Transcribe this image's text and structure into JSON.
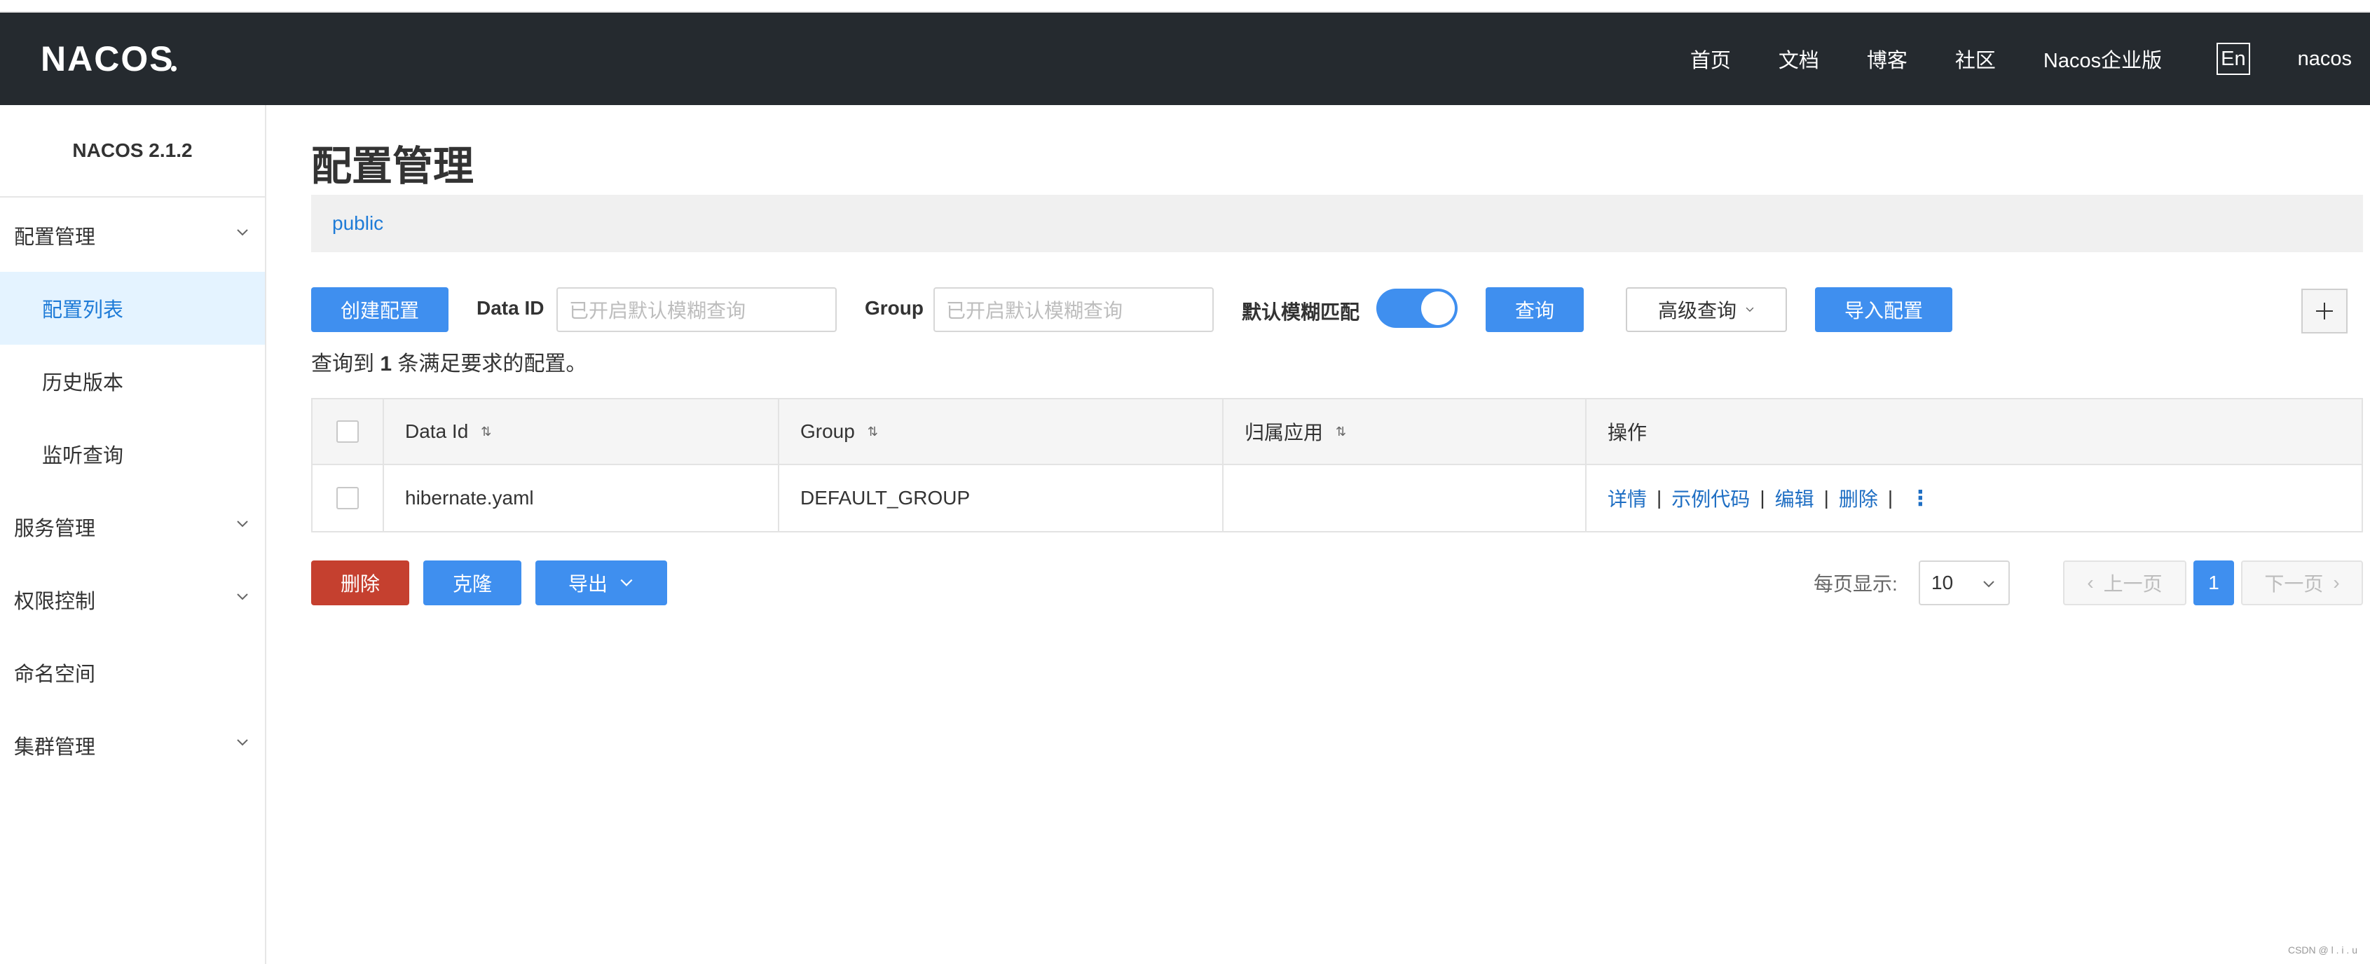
{
  "header": {
    "logo": "NACOS.",
    "nav": [
      "首页",
      "文档",
      "博客",
      "社区",
      "Nacos企业版"
    ],
    "lang": "En",
    "user": "nacos"
  },
  "sidebar": {
    "version": "NACOS 2.1.2",
    "items": [
      {
        "label": "配置管理"
      },
      {
        "label": "配置列表"
      },
      {
        "label": "历史版本"
      },
      {
        "label": "监听查询"
      },
      {
        "label": "服务管理"
      },
      {
        "label": "权限控制"
      },
      {
        "label": "命名空间"
      },
      {
        "label": "集群管理"
      }
    ]
  },
  "main": {
    "title": "配置管理",
    "namespace": "public",
    "toolbar": {
      "create": "创建配置",
      "dataid_label": "Data ID",
      "dataid_placeholder": "已开启默认模糊查询",
      "group_label": "Group",
      "group_placeholder": "已开启默认模糊查询",
      "fuzzy_label": "默认模糊匹配",
      "search": "查询",
      "advanced": "高级查询",
      "import": "导入配置"
    },
    "result": {
      "prefix": "查询到",
      "count": "1",
      "suffix": "条满足要求的配置。"
    },
    "table": {
      "headers": [
        "Data Id",
        "Group",
        "归属应用",
        "操作"
      ],
      "rows": [
        {
          "data_id": "hibernate.yaml",
          "group": "DEFAULT_GROUP",
          "app": "",
          "ops": [
            "详情",
            "示例代码",
            "编辑",
            "删除"
          ]
        }
      ]
    },
    "bottom": {
      "delete": "删除",
      "clone": "克隆",
      "export": "导出",
      "page_size_label": "每页显示:",
      "page_size": "10",
      "prev": "上一页",
      "current_page": "1",
      "next": "下一页"
    }
  },
  "colors": {
    "header_bg": "#252a2f",
    "primary": "#3f8fef",
    "danger": "#c5402f",
    "link": "#1e6ec3",
    "active_menu_bg": "#e4f3ff"
  },
  "watermark": "CSDN @ l . i . u"
}
